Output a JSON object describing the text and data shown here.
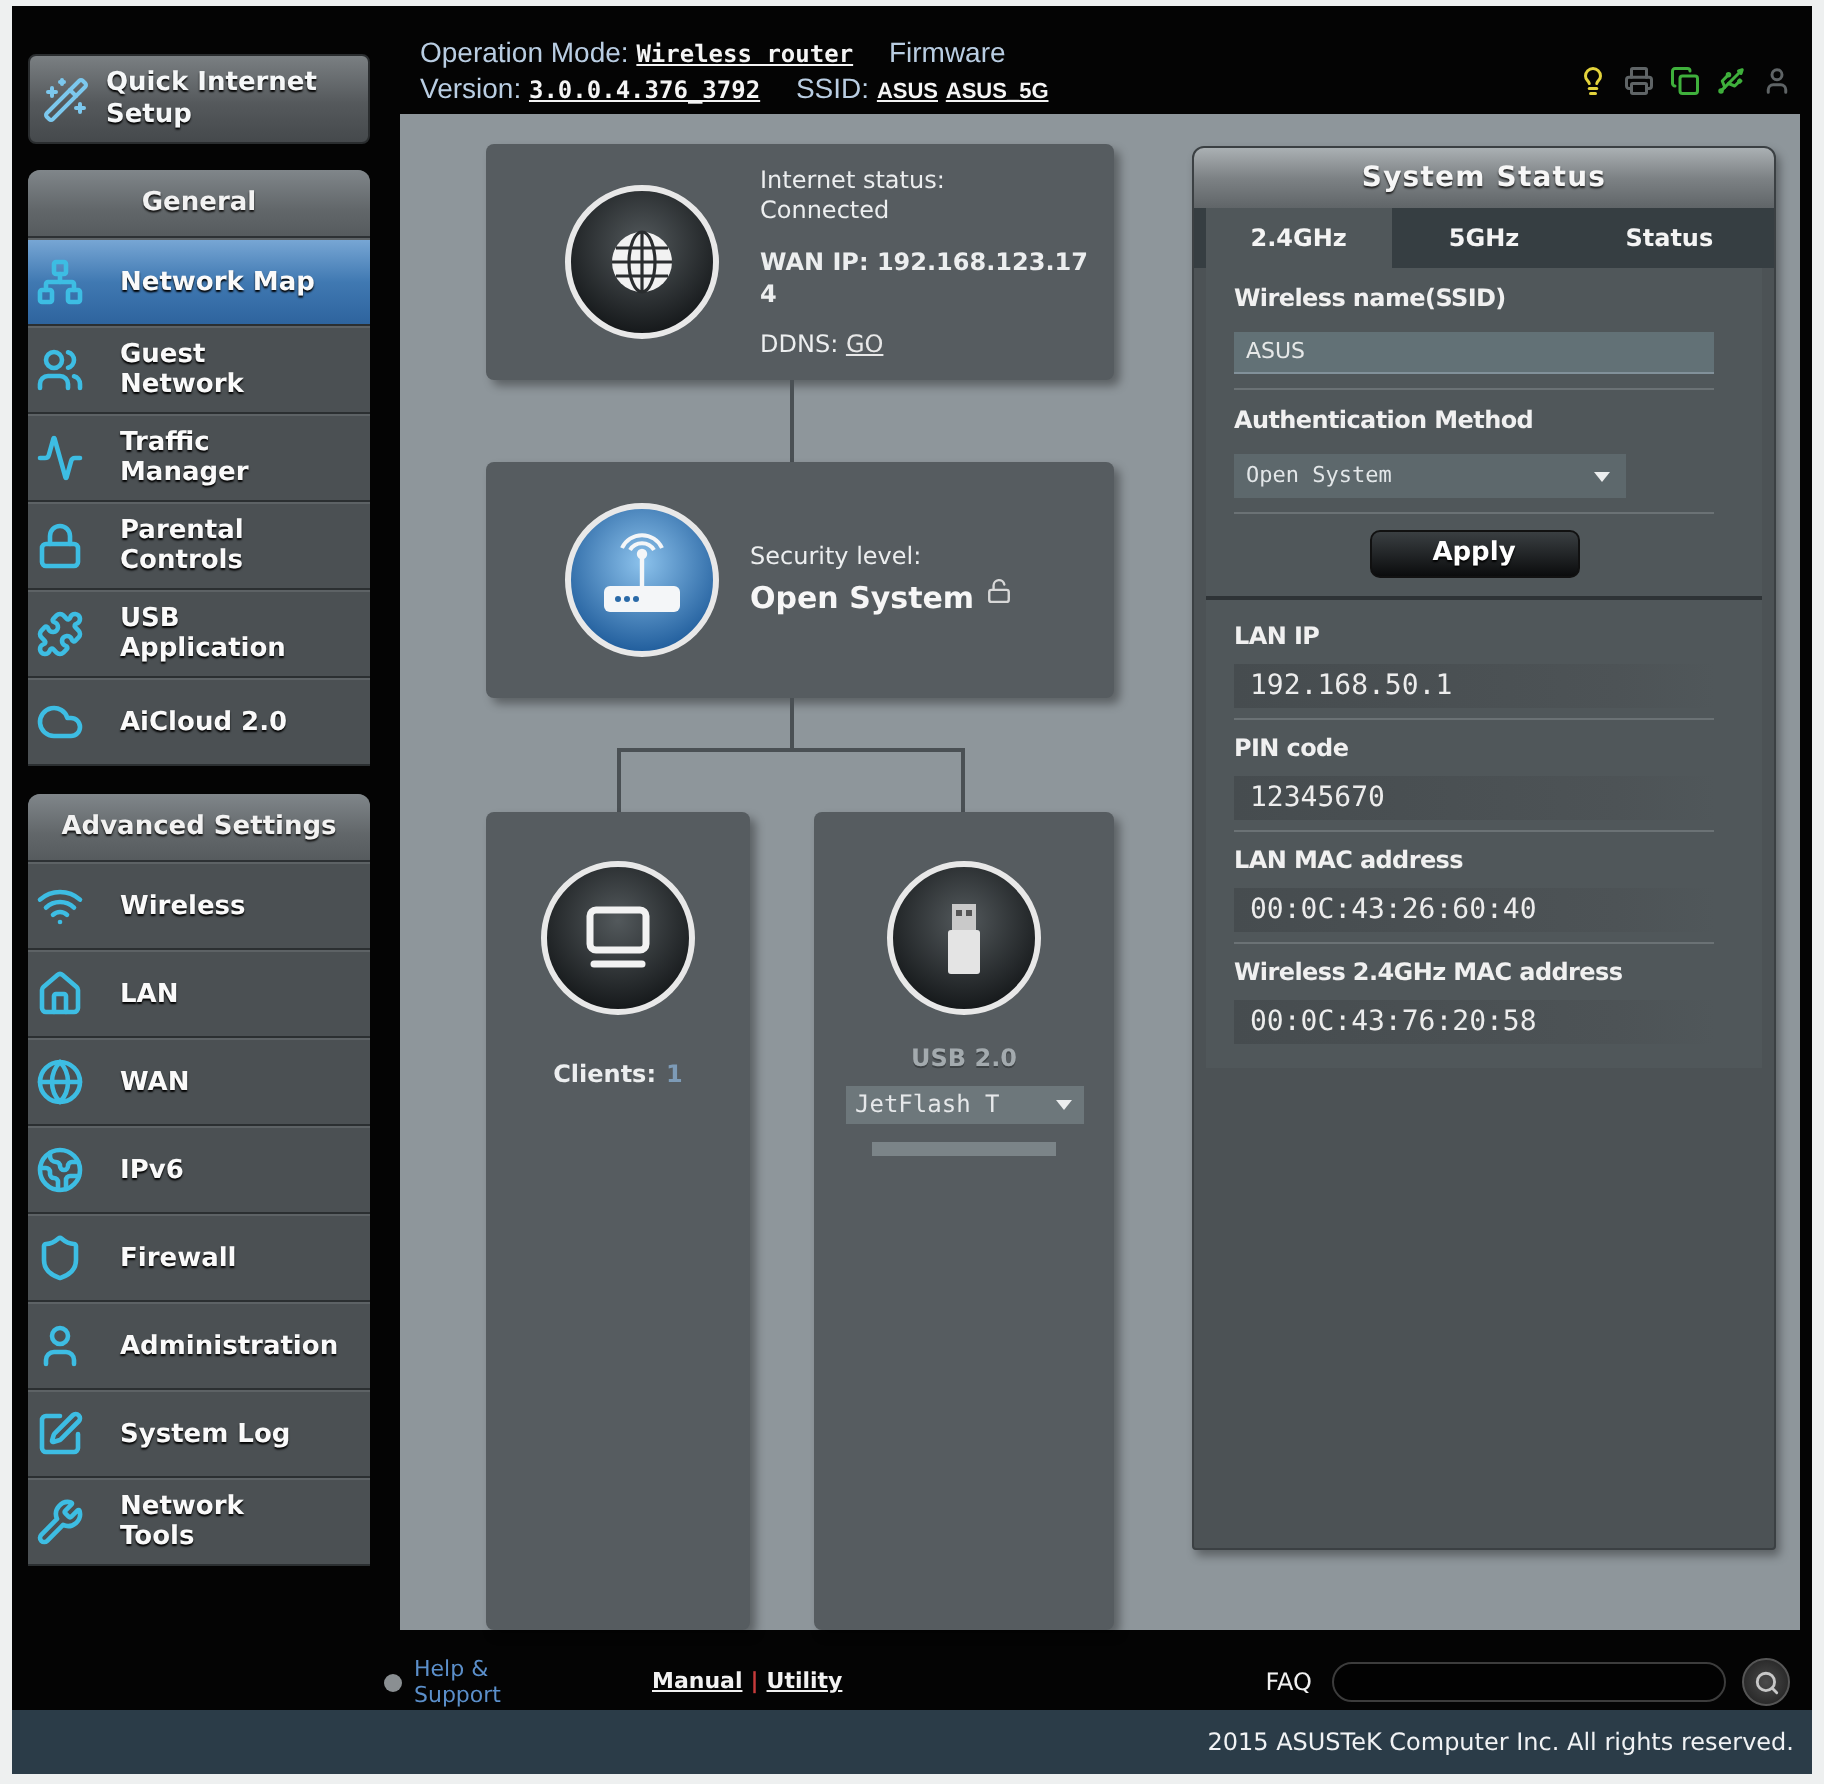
{
  "header": {
    "quick_setup": "Quick Internet Setup",
    "info": [
      {
        "kind": "label",
        "text": "Operation Mode:"
      },
      {
        "kind": "code_link",
        "text": "Wireless router"
      },
      {
        "kind": "label",
        "text": "Firmware Version:"
      },
      {
        "kind": "code_link",
        "text": "3.0.0.4.376_3792"
      },
      {
        "kind": "label",
        "text": "SSID:"
      },
      {
        "kind": "link",
        "text": "ASUS"
      },
      {
        "kind": "link",
        "text": "ASUS_5G"
      }
    ],
    "status_icons": [
      {
        "color": "#e3d33c"
      },
      {
        "color": "#5f6466"
      },
      {
        "color": "#3fb03c"
      },
      {
        "color": "#3fb03c"
      },
      {
        "color": "#5f6466"
      }
    ]
  },
  "sidebar": {
    "groups": [
      {
        "title": "General",
        "items": [
          {
            "label": "Network Map",
            "selected": true
          },
          {
            "label": "Guest\nNetwork",
            "selected": false
          },
          {
            "label": "Traffic\nManager",
            "selected": false
          },
          {
            "label": "Parental\nControls",
            "selected": false
          },
          {
            "label": "USB\nApplication",
            "selected": false
          },
          {
            "label": "AiCloud 2.0",
            "selected": false
          }
        ]
      },
      {
        "title": "Advanced Settings",
        "items": [
          {
            "label": "Wireless",
            "selected": false
          },
          {
            "label": "LAN",
            "selected": false
          },
          {
            "label": "WAN",
            "selected": false
          },
          {
            "label": "IPv6",
            "selected": false
          },
          {
            "label": "Firewall",
            "selected": false
          },
          {
            "label": "Administration",
            "selected": false
          },
          {
            "label": "System Log",
            "selected": false
          },
          {
            "label": "Network\nTools",
            "selected": false
          }
        ]
      }
    ]
  },
  "network_map": {
    "internet": {
      "status_label": "Internet status:",
      "status": "Connected",
      "wan_ip": "WAN IP: 192.168.123.174",
      "ddns_label": "DDNS:",
      "ddns_link": "GO"
    },
    "security": {
      "label": "Security level:",
      "value": "Open System"
    },
    "clients": {
      "label": "Clients:",
      "count": "1"
    },
    "usb": {
      "version": "USB 2.0",
      "device": "JetFlash T"
    }
  },
  "system_status": {
    "title": "System Status",
    "tabs": [
      {
        "label": "2.4GHz",
        "selected": true
      },
      {
        "label": "5GHz",
        "selected": false
      },
      {
        "label": "Status",
        "selected": false
      }
    ],
    "ssid_label": "Wireless name(SSID)",
    "ssid_value": "ASUS",
    "auth_label": "Authentication Method",
    "auth_value": "Open System",
    "apply": "Apply",
    "info": [
      {
        "label": "LAN IP",
        "value": "192.168.50.1"
      },
      {
        "label": "PIN code",
        "value": "12345670"
      },
      {
        "label": "LAN MAC address",
        "value": "00:0C:43:26:60:40"
      },
      {
        "label": "Wireless 2.4GHz MAC address",
        "value": "00:0C:43:76:20:58"
      }
    ]
  },
  "footer": {
    "help": "Help & Support",
    "links": [
      "Manual",
      "Utility"
    ],
    "link_separator": "|",
    "faq_label": "FAQ",
    "copyright": "2015 ASUSTeK Computer Inc. All rights reserved."
  }
}
